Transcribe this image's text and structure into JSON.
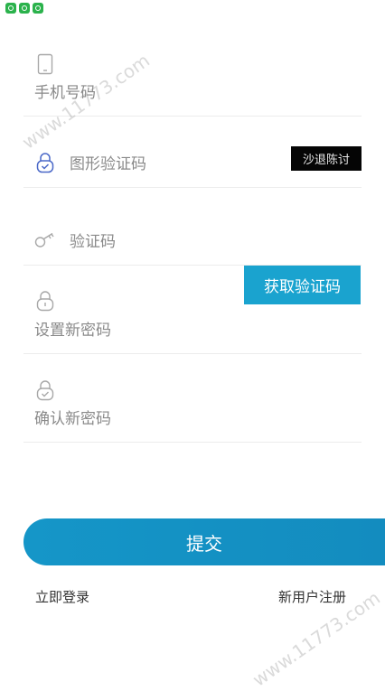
{
  "form": {
    "phone": {
      "placeholder": "手机号码"
    },
    "captcha": {
      "placeholder": "图形验证码",
      "image_text": "沙退陈讨"
    },
    "sms_code": {
      "placeholder": "验证码",
      "get_code_label": "获取验证码"
    },
    "new_password": {
      "placeholder": "设置新密码"
    },
    "confirm_password": {
      "placeholder": "确认新密码"
    },
    "submit_label": "提交"
  },
  "links": {
    "login": "立即登录",
    "register": "新用户注册"
  },
  "watermarks": [
    "www.11773.com",
    "www.11773.com"
  ],
  "colors": {
    "accent": "#1aa3cf",
    "captcha_bg": "#050505",
    "status_icon": "#2bb24c"
  },
  "icons": [
    "phone-icon",
    "lock-check-icon",
    "key-icon",
    "lock-icon",
    "lock-check-icon"
  ]
}
